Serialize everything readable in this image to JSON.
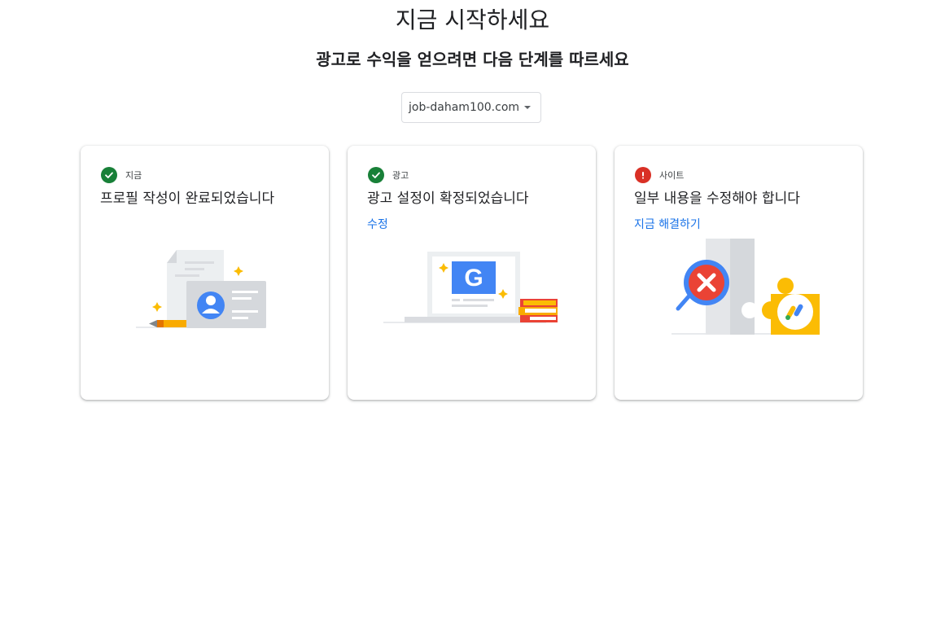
{
  "header": {
    "title": "지금 시작하세요",
    "subtitle": "광고로 수익을 얻으려면 다음 단계를 따르세요"
  },
  "site_selector": {
    "selected": "job-daham100.com"
  },
  "cards": [
    {
      "tag": "지금",
      "title": "프로필 작성이 완료되었습니다",
      "status": "complete",
      "link": ""
    },
    {
      "tag": "광고",
      "title": "광고 설정이 확정되었습니다",
      "status": "complete",
      "link": "수정"
    },
    {
      "tag": "사이트",
      "title": "일부 내용을 수정해야 합니다",
      "status": "error",
      "link": "지금 해결하기"
    }
  ],
  "colors": {
    "success": "#188038",
    "error": "#d93025",
    "link": "#1a73e8",
    "google_blue": "#4285f4",
    "google_yellow": "#fbbc04",
    "google_red": "#ea4335",
    "google_green": "#34a853"
  },
  "icons": {
    "complete": "check-circle-icon",
    "error": "error-circle-icon"
  }
}
